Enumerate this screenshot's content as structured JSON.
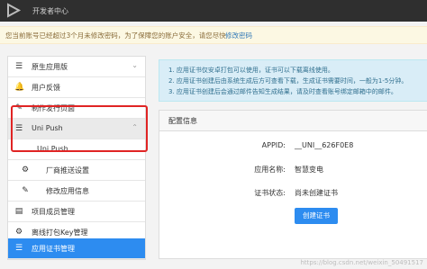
{
  "header": {
    "title": "开发者中心",
    "logo_icon": "dcloud-logo"
  },
  "notice": {
    "text": "您当前账号已经超过3个月未修改密码，为了保障您的账户安全，请您尽快",
    "link": "修改密码"
  },
  "sidebar": {
    "items": [
      {
        "label": "原生应用版",
        "icon": "list-icon"
      },
      {
        "label": "用户反馈",
        "icon": "bell-icon"
      },
      {
        "label": "制作发行页面",
        "icon": "wrench-icon"
      },
      {
        "label": "Uni Push",
        "icon": "list-icon"
      },
      {
        "label": "Uni Push",
        "icon": ""
      },
      {
        "label": "厂商推送设置",
        "icon": "gear-icon"
      },
      {
        "label": "修改应用信息",
        "icon": "edit-icon"
      },
      {
        "label": "项目成员管理",
        "icon": "clipboard-icon"
      },
      {
        "label": "离线打包Key管理",
        "icon": "gear-icon"
      },
      {
        "label": "应用证书管理",
        "icon": "list-icon"
      }
    ]
  },
  "info": {
    "lines": [
      "1. 应用证书仅安卓打包可以使用，证书可以下载离线使用。",
      "2. 应用证书创建后由系统生成后方可查看下载，生成证书需要时间，一般为1-5分钟。",
      "3. 应用证书创建后会通过邮件告知生成结果，请及时查看账号绑定邮箱中的邮件。"
    ]
  },
  "panel": {
    "title": "配置信息",
    "appid_label": "APPID:",
    "appid_value": "__UNI__626F0E8",
    "appname_label": "应用名称:",
    "appname_value": "智慧变电",
    "cert_label": "证书状态:",
    "cert_value": "尚未创建证书",
    "create_button": "创建证书"
  },
  "watermark": "https://blog.csdn.net/weixin_50491517",
  "colors": {
    "primary": "#2d8cf0",
    "highlight_border": "#e02424"
  }
}
